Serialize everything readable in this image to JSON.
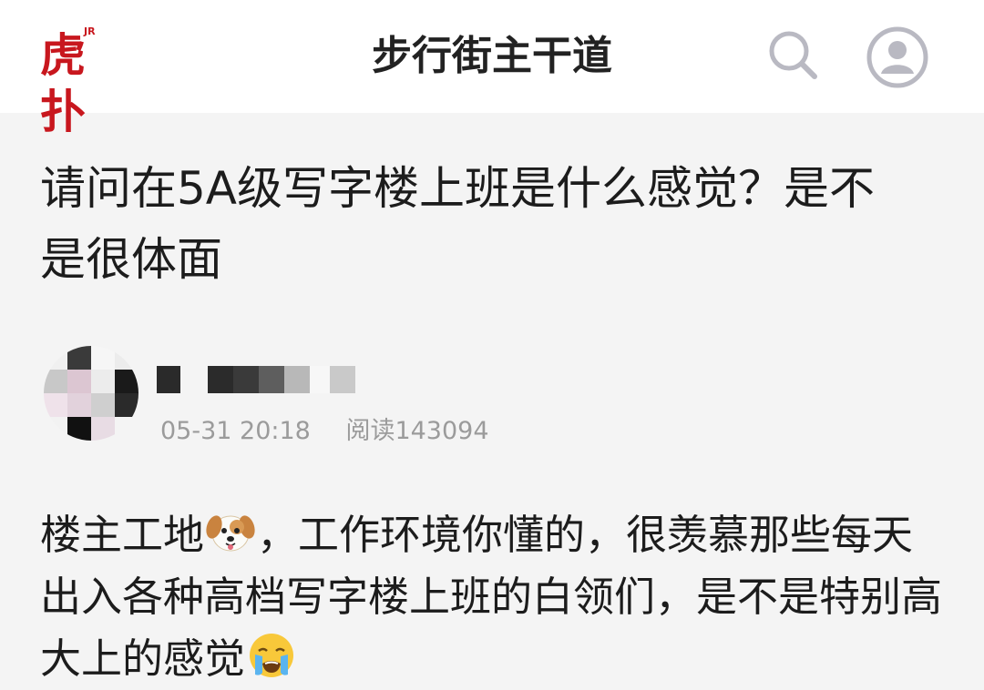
{
  "header": {
    "logo_text": "虎扑",
    "logo_badge": "JR",
    "title": "步行街主干道",
    "search_icon": "search-icon",
    "profile_icon": "user-avatar-icon"
  },
  "post": {
    "title": "请问在5A级写字楼上班是什么感觉？是不是很体面",
    "author": {
      "avatar_icon": "blurred-avatar",
      "name_blurred": true
    },
    "meta": {
      "time": "05-31 20:18",
      "views": "阅读143094"
    },
    "body": {
      "part1": "楼主工地",
      "emoji1": "dog-face-emoji",
      "part2": "，工作环境你懂的，很羡慕那些每天出入各种高档写字楼上班的白领们，是不是特别高大上的感觉",
      "emoji2": "crying-face-emoji"
    }
  },
  "colors": {
    "brand_red": "#c8171e",
    "background": "#f4f4f4",
    "topbar": "#ffffff",
    "meta_text": "#9b9b9b",
    "icon_gray": "#b9b9c2"
  }
}
